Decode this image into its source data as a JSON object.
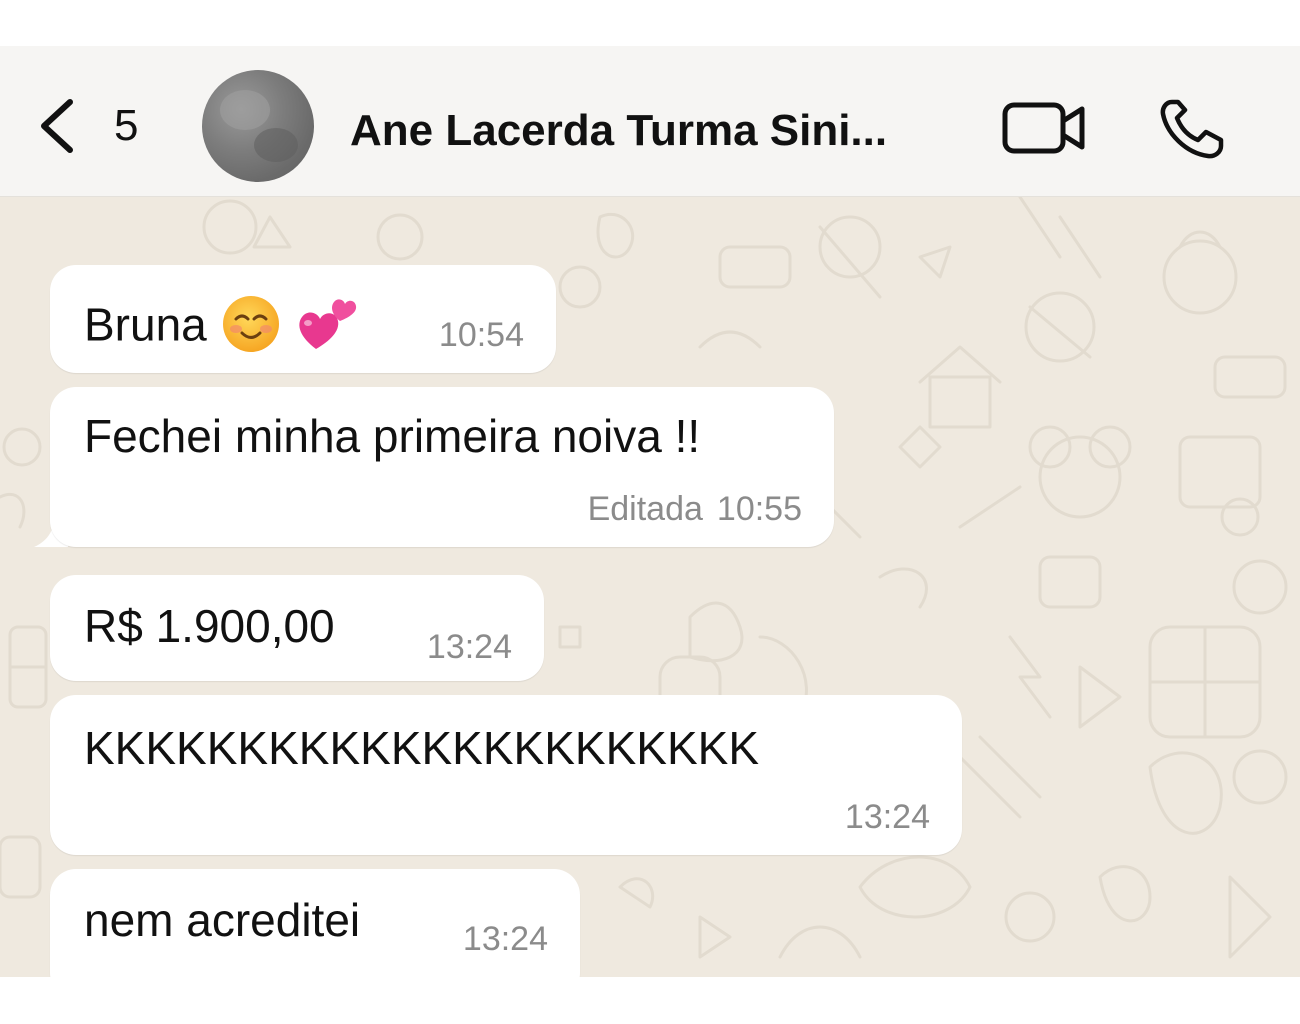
{
  "header": {
    "back_count": "5",
    "contact_name": "Ane Lacerda Turma Sini...",
    "avatar_icon": "avatar-icon",
    "video_icon": "video-camera-icon",
    "call_icon": "phone-icon"
  },
  "messages": [
    {
      "text": "Bruna",
      "emojis": [
        "smiling-face-icon",
        "two-hearts-icon"
      ],
      "edited": "",
      "time": "10:54"
    },
    {
      "text": "Fechei minha primeira noiva !!",
      "edited": "Editada",
      "time": "10:55"
    },
    {
      "text": "R$ 1.900,00",
      "edited": "",
      "time": "13:24"
    },
    {
      "text": "KKKKKKKKKKKKKKKKKKKKKK",
      "edited": "",
      "time": "13:24"
    },
    {
      "text": "nem acreditei",
      "edited": "",
      "time": "13:24"
    }
  ],
  "colors": {
    "header_bg": "#f6f5f3",
    "chat_bg": "#efe9df",
    "bubble_bg": "#ffffff",
    "meta_text": "#8b8b8b"
  }
}
